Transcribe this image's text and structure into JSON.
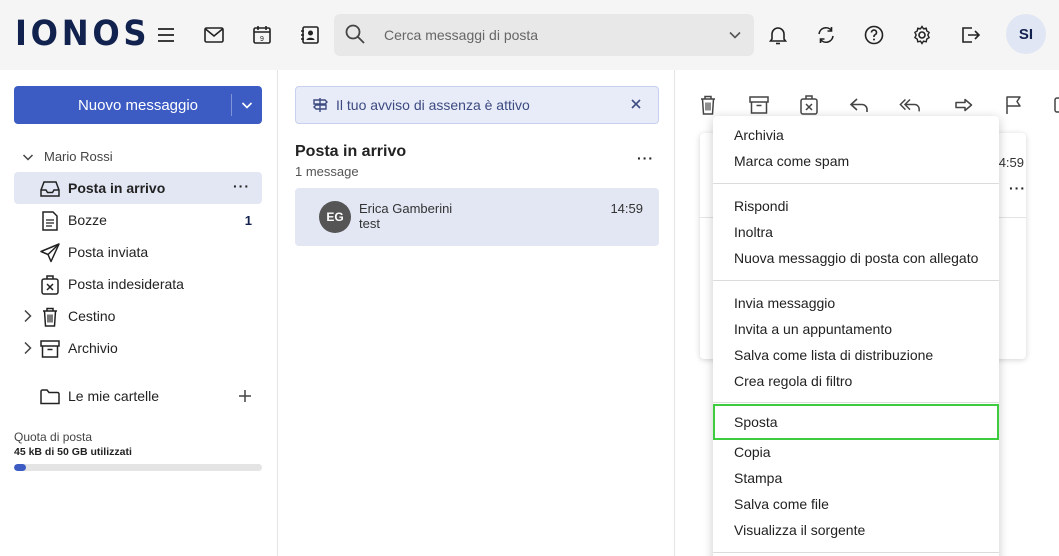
{
  "header": {
    "logo": "IONOS",
    "search_placeholder": "Cerca messaggi di posta",
    "avatar_initials": "SI"
  },
  "sidebar": {
    "new_message_label": "Nuovo messaggio",
    "account_name": "Mario Rossi",
    "folders": [
      {
        "label": "Posta in arrivo",
        "count": "",
        "selected": true
      },
      {
        "label": "Bozze",
        "count": "1"
      },
      {
        "label": "Posta inviata",
        "count": ""
      },
      {
        "label": "Posta indesiderata",
        "count": ""
      },
      {
        "label": "Cestino",
        "count": ""
      },
      {
        "label": "Archivio",
        "count": ""
      }
    ],
    "my_folders_label": "Le mie cartelle",
    "quota_label": "Quota di posta",
    "quota_value": "45 kB di 50 GB utilizzati",
    "quota_fraction": 0.05
  },
  "list": {
    "notice": "Il tuo avviso di assenza è attivo",
    "title": "Posta in arrivo",
    "count": "1 message",
    "messages": [
      {
        "initials": "EG",
        "sender": "Erica Gamberini",
        "subject": "test",
        "time": "14:59"
      }
    ]
  },
  "reader": {
    "time": "4:59"
  },
  "context_menu": {
    "group1": [
      "Archivia",
      "Marca come spam"
    ],
    "group2": [
      "Rispondi",
      "Inoltra",
      "Nuova messaggio di posta con allegato"
    ],
    "group3": [
      "Invia messaggio",
      "Invita a un appuntamento",
      "Salva come lista di distribuzione",
      "Crea regola di filtro"
    ],
    "group4": [
      "Sposta",
      "Copia",
      "Stampa",
      "Salva come file",
      "Visualizza il sorgente"
    ]
  },
  "colors": {
    "accent": "#3c5cc4",
    "logo": "#11224e",
    "highlight": "#3dcc3d"
  }
}
